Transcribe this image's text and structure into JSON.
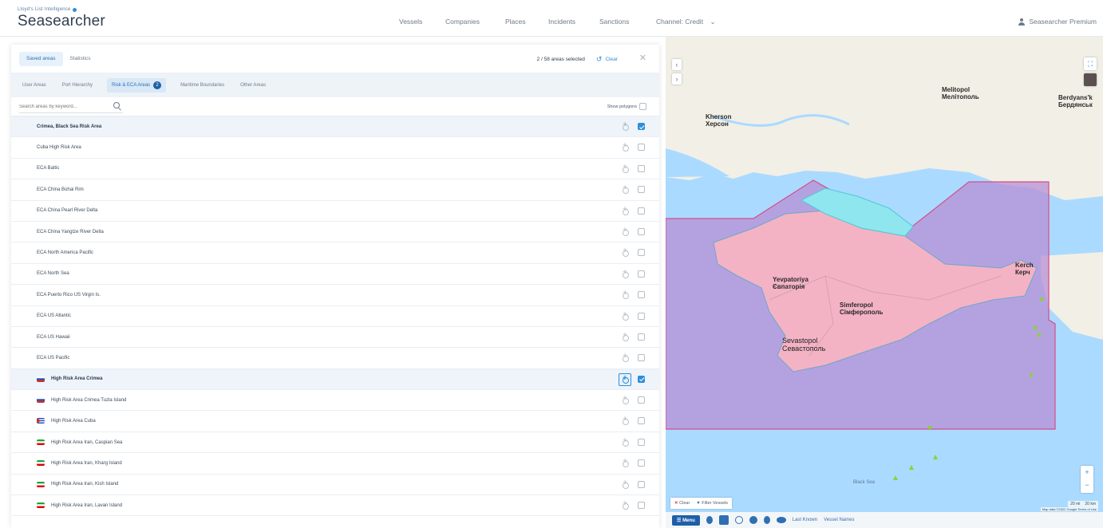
{
  "brand": {
    "tagline": "Lloyd's List Intelligence",
    "name": "Seasearcher"
  },
  "nav": {
    "items": [
      "Vessels",
      "Companies",
      "Places",
      "Incidents",
      "Sanctions",
      "Channel: Credit"
    ],
    "user": "Seasearcher Premium"
  },
  "panel": {
    "views": [
      "Saved areas",
      "Statistics"
    ],
    "selection_count": "2 / 58 areas selected",
    "clear_label": "Clear",
    "tabs": [
      {
        "label": "User Areas"
      },
      {
        "label": "Port Hierarchy"
      },
      {
        "label": "Risk & ECA Areas",
        "badge": "2"
      },
      {
        "label": "Maritime Boundaries"
      },
      {
        "label": "Other Areas"
      }
    ],
    "search_placeholder": "Search areas by keyword...",
    "show_polygons_label": "Show polygons",
    "rows": [
      {
        "name": "Crimea, Black Sea Risk Area",
        "checked": true,
        "flag": null,
        "bold": true,
        "highlight": true
      },
      {
        "name": "Cuba High Risk Area",
        "checked": false,
        "flag": null
      },
      {
        "name": "ECA Baltic",
        "checked": false,
        "flag": null
      },
      {
        "name": "ECA China Bohai Rim",
        "checked": false,
        "flag": null
      },
      {
        "name": "ECA China Pearl River Delta",
        "checked": false,
        "flag": null
      },
      {
        "name": "ECA China Yangtze River Delta",
        "checked": false,
        "flag": null
      },
      {
        "name": "ECA North America Pacific",
        "checked": false,
        "flag": null
      },
      {
        "name": "ECA North Sea",
        "checked": false,
        "flag": null
      },
      {
        "name": "ECA Puerto Rico US Virgin Is.",
        "checked": false,
        "flag": null
      },
      {
        "name": "ECA US Atlantic",
        "checked": false,
        "flag": null
      },
      {
        "name": "ECA US Hawaii",
        "checked": false,
        "flag": null
      },
      {
        "name": "ECA US Pacific",
        "checked": false,
        "flag": null
      },
      {
        "name": "High Risk Area Crimea",
        "checked": true,
        "flag": "russia",
        "bold": true,
        "highlight": true,
        "focused": true
      },
      {
        "name": "High Risk Area Crimea Tuzla Island",
        "checked": false,
        "flag": "russia"
      },
      {
        "name": "High Risk Area Cuba",
        "checked": false,
        "flag": "cuba"
      },
      {
        "name": "High Risk Area Iran, Caspian Sea",
        "checked": false,
        "flag": "iran"
      },
      {
        "name": "High Risk Area Iran, Kharg Island",
        "checked": false,
        "flag": "iran"
      },
      {
        "name": "High Risk Area Iran, Kish Island",
        "checked": false,
        "flag": "iran"
      },
      {
        "name": "High Risk Area Iran, Lavan Island",
        "checked": false,
        "flag": "iran"
      }
    ]
  },
  "map": {
    "labels": {
      "kherson": "Kherson",
      "kherson_cyr": "Херсон",
      "melitopol": "Melitopol",
      "melitopol_cyr": "Мелітополь",
      "berdyansk": "Berdyans'k",
      "berdyansk_cyr": "Бердянськ",
      "yevpatoriya": "Yevpatoriya",
      "yevpatoriya_cyr": "Євпаторія",
      "simferopol": "Simferopol",
      "simferopol_cyr": "Сімферополь",
      "sevastopol": "Sevastopol",
      "sevastopol_cyr": "Севастополь",
      "kerch": "Kerch",
      "kerch_cyr": "Керч",
      "black_sea": "Black Sea"
    },
    "filter_clear": "Clear",
    "filter_vessels": "Filter Vessels",
    "bottom": {
      "menu": "Menu",
      "last_known": "Last Known",
      "vessel_names": "Vessel Names"
    },
    "scale": [
      "20 mi",
      "20 km"
    ],
    "attribution": "Map data ©2022 Google  Terms of Use",
    "colors": {
      "risk_area": "#b78fd6",
      "crimea": "#f3b3c4",
      "sea": "#aadaff",
      "land": "#f1efe6",
      "vessel": "#8ad13a"
    }
  }
}
